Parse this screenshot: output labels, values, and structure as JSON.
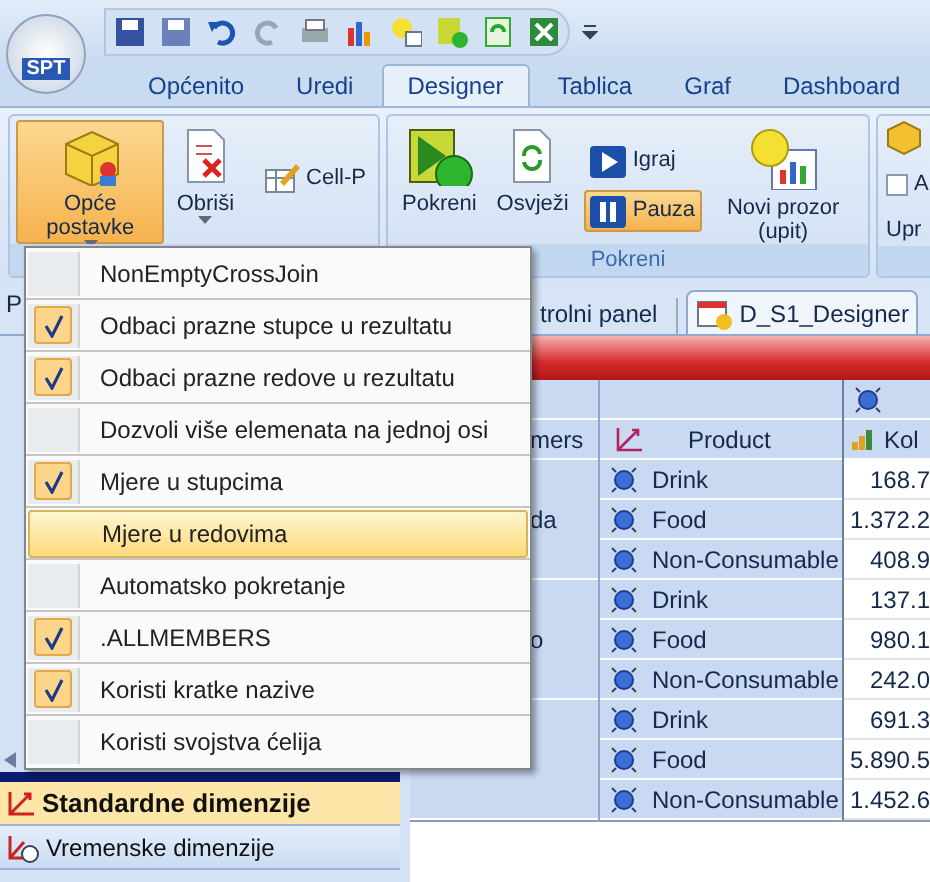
{
  "logo": {
    "text": "SPT"
  },
  "tabs": [
    {
      "label": "Općenito",
      "selected": false
    },
    {
      "label": "Uredi",
      "selected": false
    },
    {
      "label": "Designer",
      "selected": true
    },
    {
      "label": "Tablica",
      "selected": false
    },
    {
      "label": "Graf",
      "selected": false
    },
    {
      "label": "Dashboard",
      "selected": false
    }
  ],
  "ribbon_groups": [
    {
      "buttons": [
        {
          "kind": "large",
          "label": "Opće postavke",
          "selected": true,
          "dropdown": true
        },
        {
          "kind": "large",
          "label": "Obriši",
          "selected": false,
          "dropdown": true
        },
        {
          "kind": "small",
          "label": "Cell-P"
        }
      ]
    },
    {
      "label": "Pokreni",
      "buttons": [
        {
          "kind": "large",
          "label": "Pokreni",
          "selected": false
        },
        {
          "kind": "large",
          "label": "Osvježi",
          "selected": false
        },
        {
          "kind": "stack",
          "items": [
            {
              "label": "Igraj",
              "selected": false
            },
            {
              "label": "Pauza",
              "selected": true
            }
          ]
        },
        {
          "kind": "large",
          "label": "Novi prozor (upit)",
          "selected": false
        }
      ]
    },
    {
      "buttons": [
        {
          "kind": "partial",
          "checkbox_label": "A",
          "checked": false,
          "label": "Upr"
        }
      ]
    }
  ],
  "side_letter": "P",
  "doc_tabs": [
    {
      "label": "trolni panel",
      "selected": false
    },
    {
      "label": "D_S1_Designer",
      "selected": true
    }
  ],
  "menu": [
    {
      "label": "NonEmptyCrossJoin",
      "checked": false,
      "selected": false
    },
    {
      "label": "Odbaci prazne stupce u rezultatu",
      "checked": true,
      "selected": false
    },
    {
      "label": "Odbaci prazne redove u rezultatu",
      "checked": true,
      "selected": false
    },
    {
      "label": "Dozvoli više elemenata na jednoj osi",
      "checked": false,
      "selected": false
    },
    {
      "label": "Mjere u stupcima",
      "checked": true,
      "selected": false
    },
    {
      "label": "Mjere u redovima",
      "checked": false,
      "selected": true
    },
    {
      "label": "Automatsko pokretanje",
      "checked": false,
      "selected": false
    },
    {
      "label": ".ALLMEMBERS",
      "checked": true,
      "selected": false
    },
    {
      "label": "Koristi kratke nazive",
      "checked": true,
      "selected": false
    },
    {
      "label": "Koristi svojstva ćelija",
      "checked": false,
      "selected": false
    }
  ],
  "grid": {
    "columns": [
      "mers",
      "Product",
      "Kol"
    ],
    "groups": [
      {
        "label": "da",
        "rows": [
          {
            "product": "Drink",
            "value": "168.7"
          },
          {
            "product": "Food",
            "value": "1.372.2"
          },
          {
            "product": "Non-Consumable",
            "value": "408.9"
          }
        ]
      },
      {
        "label": "o",
        "rows": [
          {
            "product": "Drink",
            "value": "137.1"
          },
          {
            "product": "Food",
            "value": "980.1"
          },
          {
            "product": "Non-Consumable",
            "value": "242.0"
          }
        ]
      },
      {
        "rows": [
          {
            "product": "Drink",
            "value": "691.3"
          },
          {
            "product": "Food",
            "value": "5.890.5"
          },
          {
            "product": "Non-Consumable",
            "value": "1.452.6"
          }
        ]
      }
    ]
  },
  "nav_items": [
    {
      "label": "Standardne dimenzije",
      "selected": true
    },
    {
      "label": "Vremenske dimenzije",
      "selected": false
    }
  ]
}
